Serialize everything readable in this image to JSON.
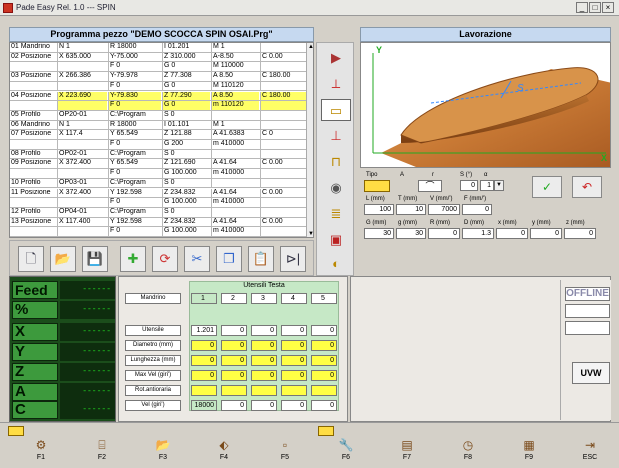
{
  "window": {
    "title": "Pade Easy Rel. 1.0 --- SPIN",
    "controls": [
      "_",
      "□",
      "×"
    ]
  },
  "program": {
    "heading": "Programma pezzo \"DEMO SCOCCA SPIN OSAI.Prg\"",
    "rows": [
      {
        "cells": [
          "01 Mandrino",
          "N 1",
          "R 18000",
          "I 01.201",
          "M 1",
          ""
        ]
      },
      {
        "cells": [
          "02 Posizione",
          "X 635.000",
          "Y-75.000",
          "Z 310.000",
          "A-8.50",
          "C 0.00"
        ]
      },
      {
        "cells": [
          "",
          "",
          "F 0",
          "G 0",
          "M 110000",
          ""
        ]
      },
      {
        "cells": [
          "03 Posizione",
          "X 266.386",
          "Y-79.978",
          "Z 77.308",
          "A 8.50",
          "C 180.00"
        ]
      },
      {
        "cells": [
          "",
          "",
          "F 0",
          "G 0",
          "M 110120",
          ""
        ]
      },
      {
        "cells": [
          "04 Posizione",
          "X 223.690",
          "Y-79.830",
          "Z 77.290",
          "A 8.50",
          "C 180.00"
        ],
        "highlight": true
      },
      {
        "cells": [
          "",
          "",
          "F 0",
          "G 0",
          "m 110120",
          ""
        ],
        "highlight": true
      },
      {
        "cells": [
          "05 Profilo",
          "OP20-01",
          "C:\\Program",
          "S 0",
          "",
          ""
        ]
      },
      {
        "cells": [
          "06 Mandrino",
          "N 1",
          "R 18000",
          "I 01.101",
          "M 1",
          ""
        ]
      },
      {
        "cells": [
          "07 Posizione",
          "X 117.4",
          "Y 65.549",
          "Z 121.88",
          "A 41.6383",
          "C 0"
        ]
      },
      {
        "cells": [
          "",
          "",
          "F 0",
          "G 200",
          "m 410000",
          ""
        ]
      },
      {
        "cells": [
          "08 Profilo",
          "OP02-01",
          "C:\\Program",
          "S 0",
          "",
          ""
        ]
      },
      {
        "cells": [
          "09 Posizione",
          "X 372.400",
          "Y 65.549",
          "Z 121.690",
          "A 41.64",
          "C 0.00"
        ]
      },
      {
        "cells": [
          "",
          "",
          "F 0",
          "G 100.000",
          "m 410000",
          ""
        ]
      },
      {
        "cells": [
          "10 Profilo",
          "OP03-01",
          "C:\\Program",
          "S 0",
          "",
          ""
        ]
      },
      {
        "cells": [
          "11 Posizione",
          "X 372.400",
          "Y 192.598",
          "Z 234.832",
          "A 41.64",
          "C 0.00"
        ]
      },
      {
        "cells": [
          "",
          "",
          "F 0",
          "G 100.000",
          "m 410000",
          ""
        ]
      },
      {
        "cells": [
          "12 Profilo",
          "OP04-01",
          "C:\\Program",
          "S 0",
          "",
          ""
        ]
      },
      {
        "cells": [
          "13 Posizione",
          "X 117.400",
          "Y 192.598",
          "Z 234.832",
          "A 41.64",
          "C 0.00"
        ]
      },
      {
        "cells": [
          "",
          "",
          "F 0",
          "G 100.000",
          "m 410000",
          ""
        ]
      }
    ]
  },
  "toolbar": {
    "icons": [
      "new-file-icon",
      "open-folder-icon",
      "save-icon",
      "add-icon",
      "refresh-icon",
      "cut-icon",
      "copy-icon",
      "paste-icon",
      "step-icon"
    ]
  },
  "lavorazione": {
    "heading": "Lavorazione",
    "axis_y": "Y",
    "axis_x": "X",
    "axis_s": "S",
    "params": {
      "labels_row1": [
        "Tipo",
        "A",
        "r",
        "S (°)",
        "α"
      ],
      "r_value": "0",
      "alpha_value": "1",
      "labels_row2": [
        "L (mm)",
        "T (mm)",
        "V (mm/')",
        "F (mm/')"
      ],
      "values_row2": [
        "100",
        "10",
        "7000",
        "0"
      ],
      "labels_row3": [
        "G (mm)",
        "g (mm)",
        "R (mm)",
        "D (mm)",
        "x (mm)",
        "y (mm)",
        "z (mm)"
      ],
      "values_row3": [
        "30",
        "30",
        "0",
        "1.3",
        "0",
        "0",
        "0"
      ]
    },
    "ok": "✓",
    "cancel": "↶"
  },
  "axes": {
    "feed_label": "Feed",
    "percent_label": "%",
    "rows": [
      {
        "label": "Feed",
        "value": "------"
      },
      {
        "label": "%",
        "value": "------"
      },
      {
        "label": "X",
        "value": "------"
      },
      {
        "label": "Y",
        "value": "------"
      },
      {
        "label": "Z",
        "value": "------"
      },
      {
        "label": "A",
        "value": "------"
      },
      {
        "label": "C",
        "value": "------"
      }
    ]
  },
  "utensili": {
    "heading": "Utensili Testa",
    "mandrino_label": "Mandrino",
    "tool_numbers": [
      "1",
      "2",
      "3",
      "4",
      "5"
    ],
    "rows": [
      {
        "label": "Utensile",
        "values": [
          "1.201",
          "0",
          "0",
          "0",
          "0"
        ]
      },
      {
        "label": "Diametro (mm)",
        "values": [
          "0",
          "0",
          "0",
          "0",
          "0"
        ]
      },
      {
        "label": "Lunghezza (mm)",
        "values": [
          "0",
          "0",
          "0",
          "0",
          "0"
        ]
      },
      {
        "label": "Max Vel (giri')",
        "values": [
          "0",
          "0",
          "0",
          "0",
          "0"
        ]
      },
      {
        "label": "Rot.antioraria",
        "values": [
          "",
          "",
          "",
          "",
          ""
        ]
      },
      {
        "label": "Vel (giri')",
        "values": [
          "18000",
          "0",
          "0",
          "0",
          "0"
        ]
      }
    ]
  },
  "status": {
    "offline": "OFFLINE",
    "uvw": "UVW"
  },
  "fkeys": [
    {
      "label": "F1",
      "icon": "machine-icon"
    },
    {
      "label": "F2",
      "icon": "tool-icon"
    },
    {
      "label": "F3",
      "icon": "open-folder-icon"
    },
    {
      "label": "F4",
      "icon": "pin-icon"
    },
    {
      "label": "F5",
      "icon": "blank-icon"
    },
    {
      "label": "F6",
      "icon": "wrench-icon"
    },
    {
      "label": "F7",
      "icon": "iso-icon"
    },
    {
      "label": "F8",
      "icon": "clock-icon"
    },
    {
      "label": "F9",
      "icon": "calculator-icon"
    },
    {
      "label": "ESC",
      "icon": "exit-icon"
    }
  ]
}
